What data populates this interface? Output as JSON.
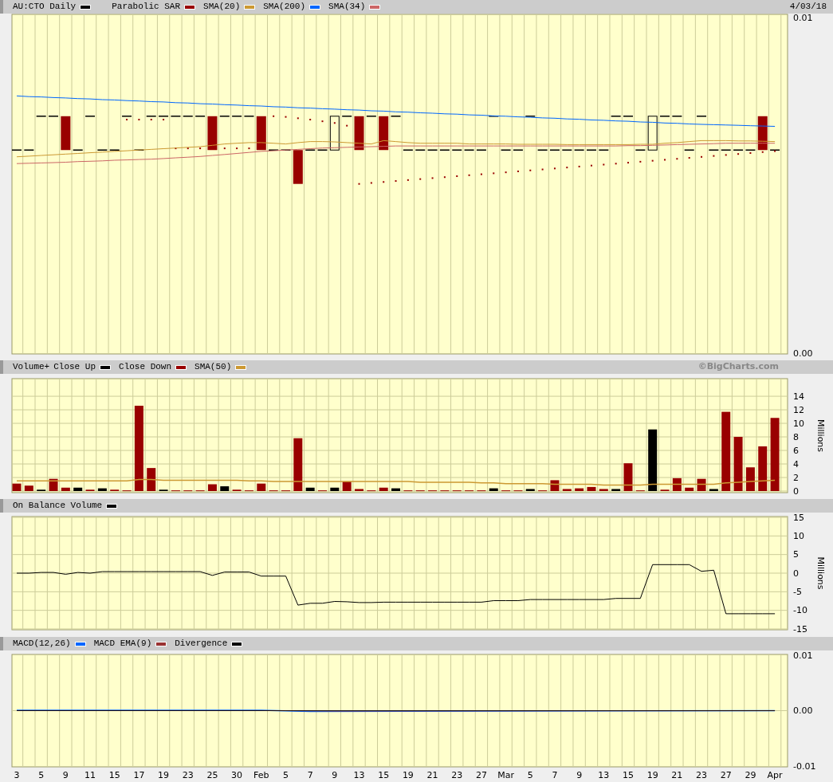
{
  "price_panel": {
    "legend_before": [
      {
        "label": "AU:CTO Daily",
        "color": "#000000"
      },
      {
        "label": "Parabolic SAR",
        "color": "#990000"
      }
    ],
    "date": "4/03/18",
    "chart_data": {
      "type": "line",
      "ylim": [
        0,
        0.01
      ],
      "yticks": [
        {
          "value": 0,
          "label": "0.00"
        },
        {
          "value": 0.01,
          "label": "0.01"
        }
      ],
      "series": [
        {
          "name": "SMA(20)",
          "color": "#cc9933",
          "values": [
            0.0058,
            0.00582,
            0.00584,
            0.00586,
            0.00588,
            0.0059,
            0.00592,
            0.00594,
            0.00596,
            0.00598,
            0.006,
            0.00602,
            0.00604,
            0.00606,
            0.00608,
            0.0061,
            0.00614,
            0.00618,
            0.0062,
            0.00622,
            0.00622,
            0.0062,
            0.00618,
            0.00622,
            0.00625,
            0.00625,
            0.00624,
            0.00622,
            0.0062,
            0.00618,
            0.00628,
            0.00625,
            0.00622,
            0.0062,
            0.0062,
            0.0062,
            0.0062,
            0.00618,
            0.00618,
            0.00618,
            0.00618,
            0.00617,
            0.00617,
            0.00617,
            0.00617,
            0.00616,
            0.00616,
            0.00616,
            0.00616,
            0.00616,
            0.00616,
            0.00617,
            0.00617,
            0.0062,
            0.00622,
            0.00625,
            0.00628,
            0.00628,
            0.00628,
            0.00627,
            0.00627,
            0.00626,
            0.00625
          ]
        },
        {
          "name": "SMA(200)",
          "color": "#0066ff",
          "values": [
            0.0076,
            0.00758,
            0.00757,
            0.00755,
            0.00754,
            0.00752,
            0.00751,
            0.00749,
            0.00748,
            0.00746,
            0.00745,
            0.00743,
            0.00742,
            0.0074,
            0.00739,
            0.00737,
            0.00736,
            0.00734,
            0.00733,
            0.00731,
            0.0073,
            0.00728,
            0.00727,
            0.00725,
            0.00724,
            0.00722,
            0.00721,
            0.00719,
            0.00718,
            0.00716,
            0.00715,
            0.00713,
            0.00712,
            0.0071,
            0.00709,
            0.00707,
            0.00706,
            0.00704,
            0.00703,
            0.00701,
            0.007,
            0.00698,
            0.00697,
            0.00695,
            0.00694,
            0.00692,
            0.00691,
            0.00689,
            0.00688,
            0.00686,
            0.00685,
            0.00683,
            0.00682,
            0.0068,
            0.00679,
            0.00677,
            0.00676,
            0.00675,
            0.00674,
            0.00673,
            0.00672,
            0.00671,
            0.0067
          ]
        },
        {
          "name": "SMA(34)",
          "color": "#cc6666",
          "values": [
            0.0056,
            0.00561,
            0.00562,
            0.00563,
            0.00564,
            0.00566,
            0.00567,
            0.00568,
            0.0057,
            0.00571,
            0.00572,
            0.00573,
            0.00575,
            0.00577,
            0.00579,
            0.00581,
            0.00584,
            0.00587,
            0.0059,
            0.00593,
            0.00596,
            0.00598,
            0.006,
            0.00602,
            0.00604,
            0.00606,
            0.00607,
            0.00608,
            0.00609,
            0.0061,
            0.00611,
            0.00612,
            0.00612,
            0.00612,
            0.00612,
            0.00612,
            0.00612,
            0.00612,
            0.00612,
            0.00612,
            0.00612,
            0.00612,
            0.00612,
            0.00612,
            0.00612,
            0.00612,
            0.00612,
            0.00612,
            0.00612,
            0.00612,
            0.00613,
            0.00613,
            0.00614,
            0.00615,
            0.00616,
            0.00617,
            0.00618,
            0.00619,
            0.0062,
            0.0062,
            0.0062,
            0.0062,
            0.0062
          ]
        }
      ]
    }
  },
  "volume_panel": {
    "legend_after": [
      {
        "label": "SMA(50)",
        "color": "#cc9933"
      }
    ],
    "copyright": "©BigCharts.com",
    "chart_data": {
      "type": "bar",
      "title": "Volume+",
      "ylabel": "Millions",
      "stacked": true,
      "grid": true,
      "ylim": [
        0,
        16.6
      ],
      "yticks": [
        0,
        2,
        4,
        6,
        8,
        10,
        12,
        14
      ],
      "series": [
        {
          "name": "Close Up",
          "color": "#000000",
          "values": [
            null,
            null,
            0.2,
            null,
            null,
            0.5,
            null,
            0.4,
            null,
            null,
            null,
            null,
            0.2,
            null,
            null,
            null,
            null,
            0.7,
            null,
            null,
            null,
            null,
            null,
            null,
            0.5,
            null,
            0.5,
            null,
            null,
            null,
            null,
            0.4,
            null,
            null,
            null,
            null,
            null,
            null,
            null,
            0.4,
            null,
            null,
            0.3,
            null,
            null,
            null,
            null,
            null,
            null,
            0.3,
            null,
            null,
            9.1,
            null,
            null,
            null,
            null,
            0.3,
            null,
            null,
            null,
            null,
            null
          ]
        },
        {
          "name": "Close Down",
          "color": "#990000",
          "values": [
            1.1,
            0.8,
            null,
            1.8,
            0.5,
            null,
            0.2,
            null,
            0.2,
            0.1,
            12.6,
            3.4,
            null,
            0.1,
            0.1,
            0.1,
            1.0,
            null,
            0.2,
            0.1,
            1.1,
            0.1,
            0.1,
            7.8,
            null,
            0.1,
            null,
            1.4,
            0.3,
            0.1,
            0.5,
            null,
            0.1,
            0.1,
            0.1,
            0.1,
            0.1,
            0.1,
            0.1,
            null,
            0.1,
            0.1,
            null,
            0.1,
            1.6,
            0.3,
            0.4,
            0.6,
            0.3,
            null,
            4.1,
            0.1,
            null,
            0.2,
            1.9,
            0.5,
            1.8,
            null,
            11.7,
            8.0,
            3.5,
            6.6,
            10.8
          ]
        }
      ]
    }
  },
  "obv_panel": {
    "chart_data": {
      "type": "line",
      "ylabel": "Millions",
      "grid": true,
      "ylim": [
        -15,
        15
      ],
      "yticks": [
        -15,
        -10,
        -5,
        0,
        5,
        10,
        15
      ],
      "series": [
        {
          "name": "On Balance Volume",
          "color": "#000000",
          "values": [
            0,
            0,
            0.2,
            0.2,
            -0.3,
            0.2,
            0,
            0.4,
            0.4,
            0.4,
            0.4,
            0.4,
            0.4,
            0.4,
            0.4,
            0.4,
            -0.6,
            0.3,
            0.3,
            0.3,
            -0.8,
            -0.8,
            -0.8,
            -8.6,
            -8.1,
            -8.1,
            -7.6,
            -7.7,
            -7.9,
            -7.9,
            -7.8,
            -7.8,
            -7.8,
            -7.8,
            -7.8,
            -7.8,
            -7.8,
            -7.8,
            -7.8,
            -7.4,
            -7.4,
            -7.4,
            -7.1,
            -7.1,
            -7.1,
            -7.1,
            -7.1,
            -7.1,
            -7.1,
            -6.8,
            -6.8,
            -6.8,
            2.3,
            2.3,
            2.3,
            2.3,
            0.5,
            0.8,
            -10.9,
            -10.9,
            -10.9,
            -10.9,
            -10.9
          ]
        }
      ]
    }
  },
  "macd_panel": {
    "legend": [
      {
        "label": "MACD(12,26)",
        "color": "#0066ff"
      },
      {
        "label": "MACD EMA(9)",
        "color": "#993333"
      },
      {
        "label": "Divergence",
        "color": "#000000"
      }
    ],
    "y_labels": [
      "0.01",
      "0.00",
      "-0.01"
    ],
    "x_labels": [
      "3",
      "5",
      "9",
      "11",
      "15",
      "17",
      "19",
      "23",
      "25",
      "30",
      "Feb",
      "5",
      "7",
      "9",
      "13",
      "15",
      "19",
      "21",
      "23",
      "27",
      "Mar",
      "5",
      "7",
      "9",
      "13",
      "15",
      "19",
      "21",
      "23",
      "27",
      "29",
      "Apr"
    ]
  }
}
